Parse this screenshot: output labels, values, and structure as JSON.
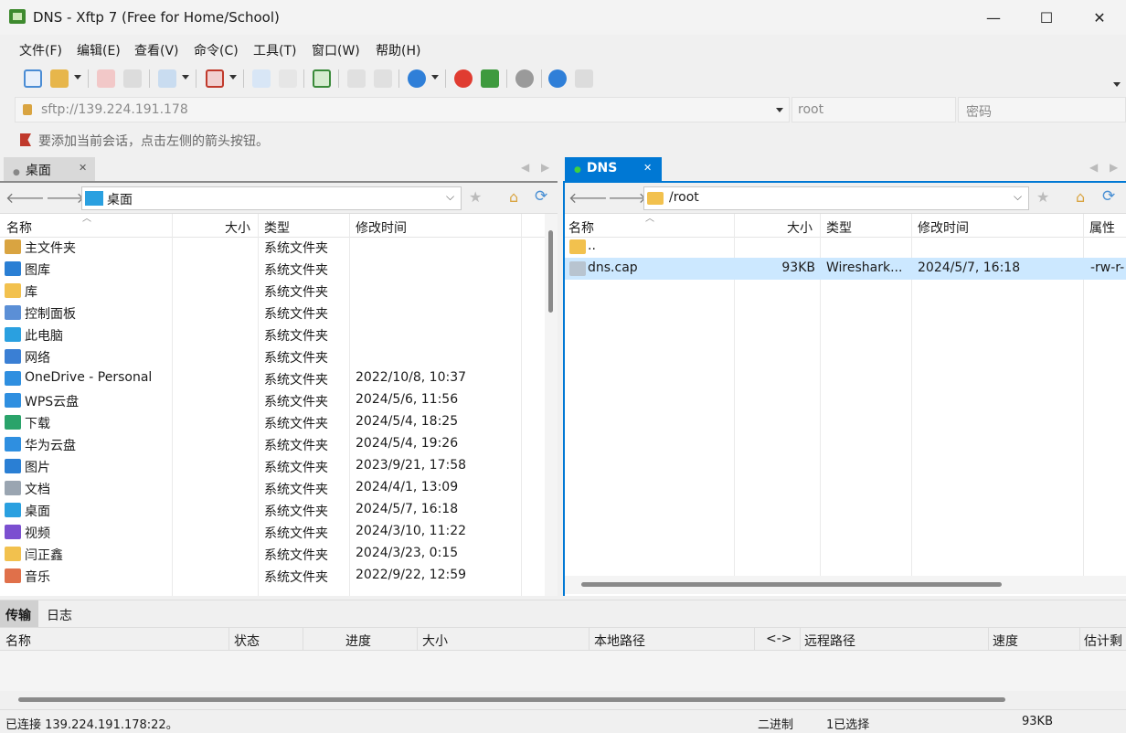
{
  "window": {
    "title": "DNS - Xftp 7 (Free for Home/School)",
    "minimize": "—",
    "maximize": "☐",
    "close": "✕"
  },
  "menu": [
    "文件(F)",
    "编辑(E)",
    "查看(V)",
    "命令(C)",
    "工具(T)",
    "窗口(W)",
    "帮助(H)"
  ],
  "address": {
    "url": "sftp://139.224.191.178",
    "user_placeholder": "root",
    "password_placeholder": "密码"
  },
  "hint": "要添加当前会话，点击左侧的箭头按钮。",
  "left_pane": {
    "tab_label": "桌面",
    "path": "桌面",
    "columns": [
      "名称",
      "大小",
      "类型",
      "修改时间"
    ],
    "rows": [
      {
        "name": "主文件夹",
        "size": "",
        "type": "系统文件夹",
        "modified": "",
        "icon": "home-icon"
      },
      {
        "name": "图库",
        "size": "",
        "type": "系统文件夹",
        "modified": "",
        "icon": "gallery-icon"
      },
      {
        "name": "库",
        "size": "",
        "type": "系统文件夹",
        "modified": "",
        "icon": "library-folder-icon"
      },
      {
        "name": "控制面板",
        "size": "",
        "type": "系统文件夹",
        "modified": "",
        "icon": "control-panel-icon"
      },
      {
        "name": "此电脑",
        "size": "",
        "type": "系统文件夹",
        "modified": "",
        "icon": "computer-icon"
      },
      {
        "name": "网络",
        "size": "",
        "type": "系统文件夹",
        "modified": "",
        "icon": "network-icon"
      },
      {
        "name": "OneDrive - Personal",
        "size": "",
        "type": "系统文件夹",
        "modified": "2022/10/8, 10:37",
        "icon": "cloud-icon"
      },
      {
        "name": "WPS云盘",
        "size": "",
        "type": "系统文件夹",
        "modified": "2024/5/6, 11:56",
        "icon": "cloud-icon"
      },
      {
        "name": "下载",
        "size": "",
        "type": "系统文件夹",
        "modified": "2024/5/4, 18:25",
        "icon": "download-icon"
      },
      {
        "name": "华为云盘",
        "size": "",
        "type": "系统文件夹",
        "modified": "2024/5/4, 19:26",
        "icon": "cloud-icon"
      },
      {
        "name": "图片",
        "size": "",
        "type": "系统文件夹",
        "modified": "2023/9/21, 17:58",
        "icon": "pictures-icon"
      },
      {
        "name": "文档",
        "size": "",
        "type": "系统文件夹",
        "modified": "2024/4/1, 13:09",
        "icon": "document-icon"
      },
      {
        "name": "桌面",
        "size": "",
        "type": "系统文件夹",
        "modified": "2024/5/7, 16:18",
        "icon": "desktop-icon"
      },
      {
        "name": "视频",
        "size": "",
        "type": "系统文件夹",
        "modified": "2024/3/10, 11:22",
        "icon": "video-icon"
      },
      {
        "name": "闫正鑫",
        "size": "",
        "type": "系统文件夹",
        "modified": "2024/3/23, 0:15",
        "icon": "folder-icon"
      },
      {
        "name": "音乐",
        "size": "",
        "type": "系统文件夹",
        "modified": "2022/9/22, 12:59",
        "icon": "music-icon"
      }
    ]
  },
  "right_pane": {
    "tab_label": "DNS",
    "path": "/root",
    "columns": [
      "名称",
      "大小",
      "类型",
      "修改时间",
      "属性"
    ],
    "rows": [
      {
        "name": "..",
        "size": "",
        "type": "",
        "modified": "",
        "attr": "",
        "icon": "folder-icon"
      },
      {
        "name": "dns.cap",
        "size": "93KB",
        "type": "Wireshark...",
        "modified": "2024/5/7, 16:18",
        "attr": "-rw-r-",
        "icon": "file-icon"
      }
    ]
  },
  "transfer": {
    "tabs": [
      "传输",
      "日志"
    ],
    "columns": [
      "名称",
      "状态",
      "进度",
      "大小",
      "本地路径",
      "<->",
      "远程路径",
      "速度",
      "估计剩"
    ]
  },
  "status": {
    "connection": "已连接 139.224.191.178:22。",
    "mode": "二进制",
    "selection": "1已选择",
    "size": "93KB"
  },
  "colors": {
    "accent": "#0078d4",
    "selected_row": "#cce8ff",
    "active_tab": "#0078d4"
  }
}
